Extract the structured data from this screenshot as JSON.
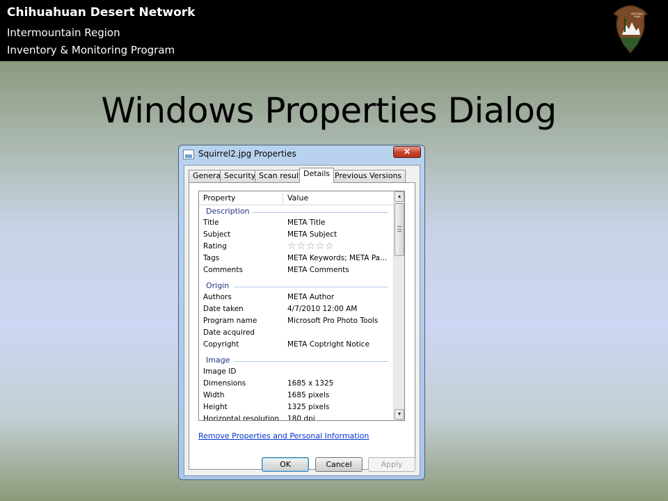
{
  "banner": {
    "line1": "Chihuahuan Desert Network",
    "line2": "Intermountain Region",
    "line3": "Inventory & Monitoring Program",
    "logo": "nps-arrowhead-logo"
  },
  "slide_title": "Windows Properties Dialog",
  "dialog": {
    "title": "Squirrel2.jpg Properties",
    "close_label": "✕",
    "tabs": [
      "General",
      "Security",
      "Scan results",
      "Details",
      "Previous Versions"
    ],
    "active_tab": "Details",
    "columns": {
      "property": "Property",
      "value": "Value"
    },
    "groups": {
      "description": "Description",
      "origin": "Origin",
      "image": "Image"
    },
    "description_rows": [
      {
        "property": "Title",
        "value": "META Title"
      },
      {
        "property": "Subject",
        "value": "META Subject"
      },
      {
        "property": "Rating",
        "value": "☆☆☆☆☆"
      },
      {
        "property": "Tags",
        "value": "META Keywords; META Pa..."
      },
      {
        "property": "Comments",
        "value": "META Comments"
      }
    ],
    "origin_rows": [
      {
        "property": "Authors",
        "value": "META Author"
      },
      {
        "property": "Date taken",
        "value": "4/7/2010 12:00 AM"
      },
      {
        "property": "Program name",
        "value": "Microsoft Pro Photo Tools"
      },
      {
        "property": "Date acquired",
        "value": ""
      },
      {
        "property": "Copyright",
        "value": "META Coptright Notice"
      }
    ],
    "image_rows": [
      {
        "property": "Image ID",
        "value": ""
      },
      {
        "property": "Dimensions",
        "value": "1685 x 1325"
      },
      {
        "property": "Width",
        "value": "1685 pixels"
      },
      {
        "property": "Height",
        "value": "1325 pixels"
      },
      {
        "property": "Horizontal resolution",
        "value": "180 dpi"
      }
    ],
    "remove_link": "Remove Properties and Personal Information",
    "buttons": {
      "ok": "OK",
      "cancel": "Cancel",
      "apply": "Apply"
    }
  }
}
